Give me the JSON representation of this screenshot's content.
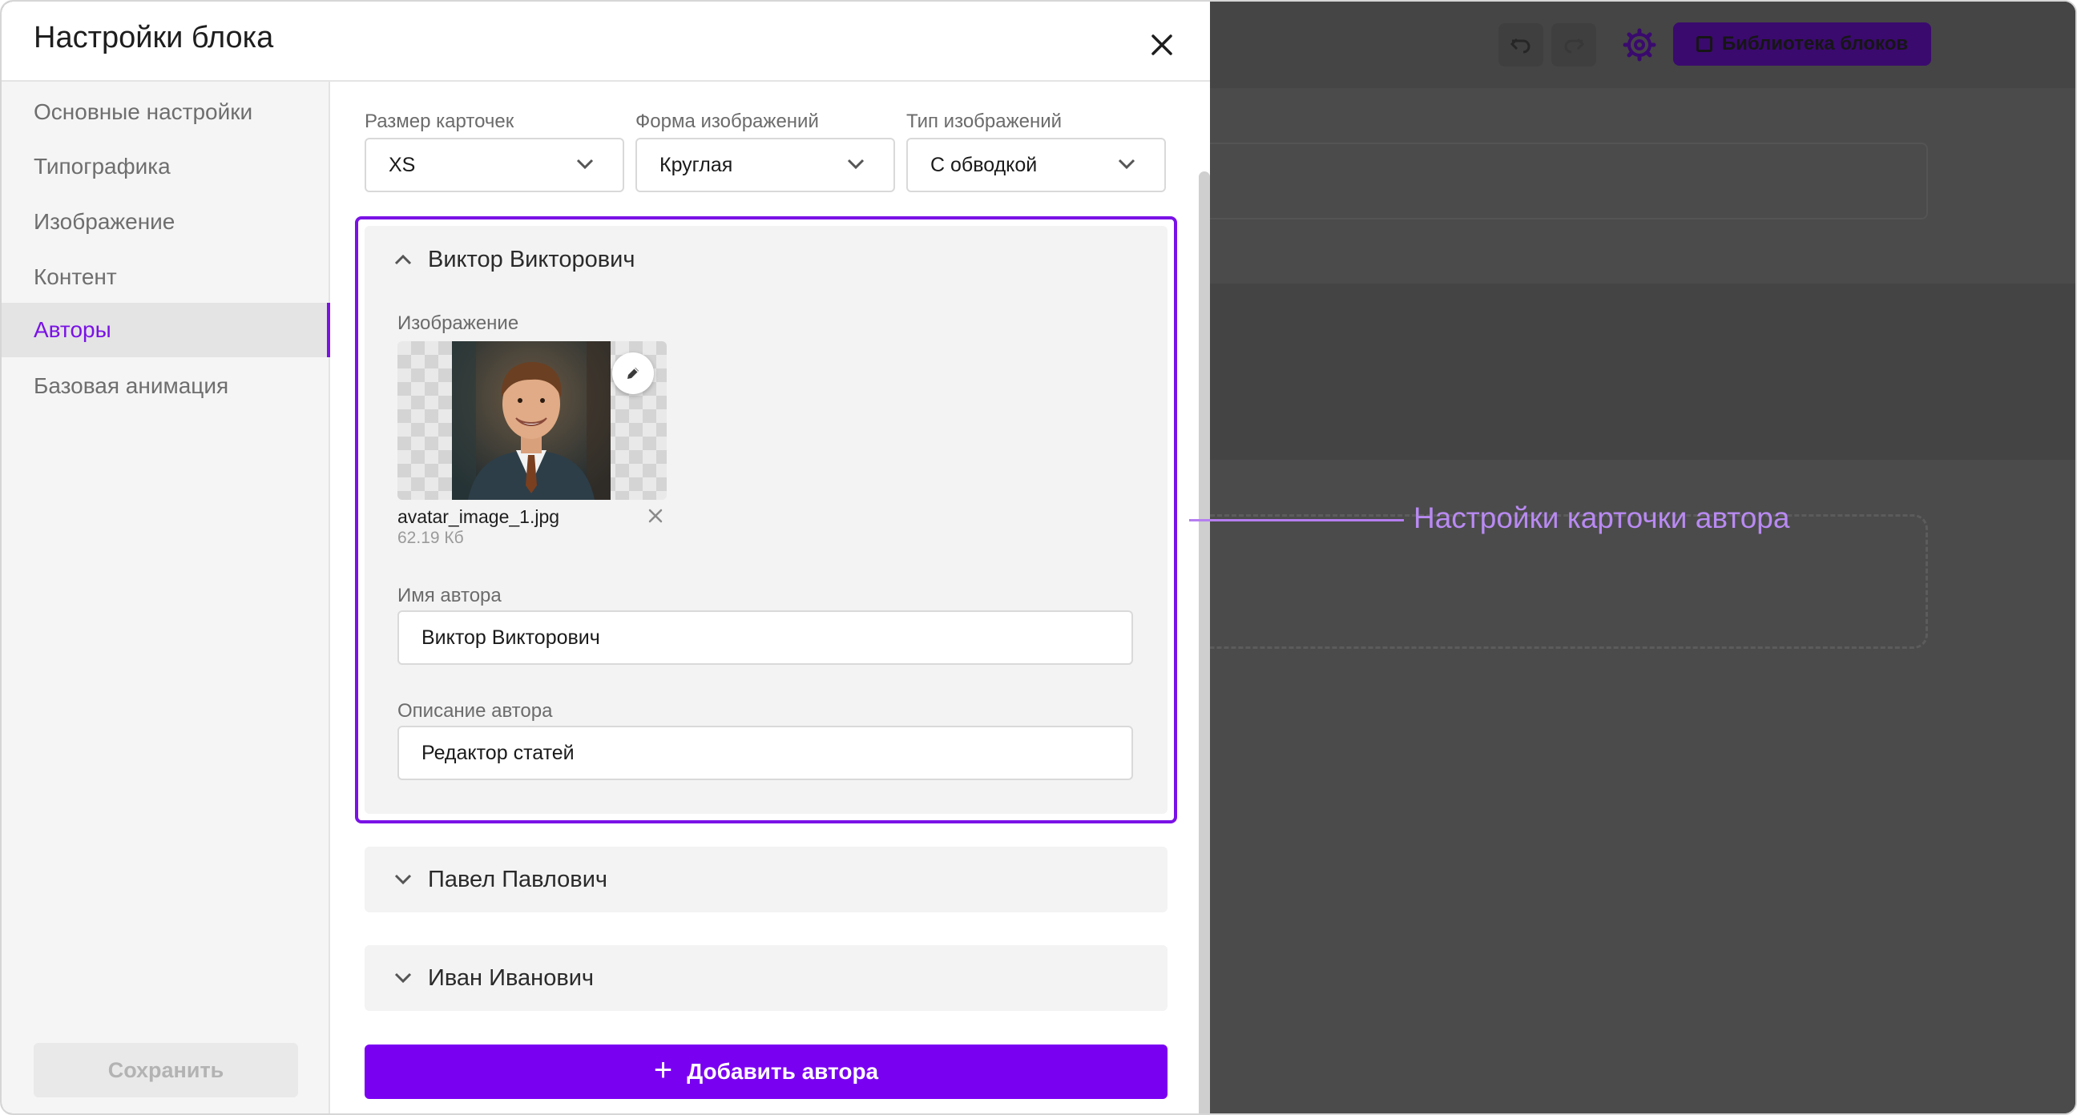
{
  "dialog": {
    "title": "Настройки блока",
    "close_icon": "close-icon"
  },
  "sidebar": {
    "items": [
      {
        "label": "Основные настройки",
        "active": false
      },
      {
        "label": "Типографика",
        "active": false
      },
      {
        "label": "Изображение",
        "active": false
      },
      {
        "label": "Контент",
        "active": false
      },
      {
        "label": "Авторы",
        "active": true
      },
      {
        "label": "Базовая анимация",
        "active": false
      }
    ],
    "save_label": "Сохранить"
  },
  "selects": [
    {
      "label": "Размер карточек",
      "value": "XS"
    },
    {
      "label": "Форма изображений",
      "value": "Круглая"
    },
    {
      "label": "Тип изображений",
      "value": "С обводкой"
    }
  ],
  "authors": {
    "expanded": {
      "name": "Виктор Викторович",
      "image_label": "Изображение",
      "file_name": "avatar_image_1.jpg",
      "file_size": "62.19 Кб",
      "name_label": "Имя автора",
      "name_value": "Виктор Викторович",
      "desc_label": "Описание автора",
      "desc_value": "Редактор статей"
    },
    "collapsed": [
      {
        "name": "Павел Павлович"
      },
      {
        "name": "Иван Иванович"
      }
    ],
    "add_label": "Добавить автора"
  },
  "overlay": {
    "library_label": "Библиотека блоков",
    "icons": [
      "undo-icon",
      "redo-icon",
      "gear-icon",
      "image-icon"
    ]
  },
  "callout": {
    "text": "Настройки карточки автора"
  },
  "colors": {
    "accent": "#7a12e6",
    "button": "#7a00f2",
    "callout": "#b98af2",
    "overlay": "#4b4b4b"
  }
}
